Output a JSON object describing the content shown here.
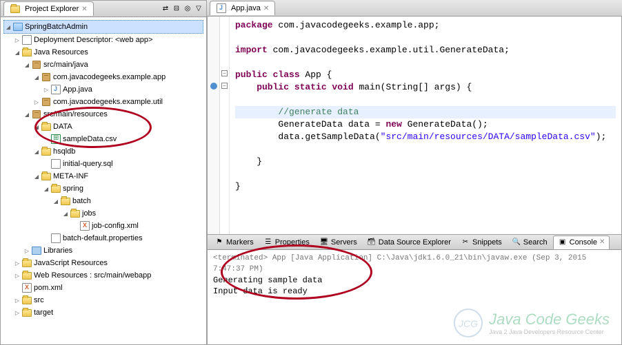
{
  "explorer": {
    "title": "Project Explorer",
    "project": "SpringBatchAdmin",
    "deploymentDescriptor": "Deployment Descriptor: <web app>",
    "javaResources": "Java Resources",
    "srcMainJava": "src/main/java",
    "pkgApp": "com.javacodegeeks.example.app",
    "appJava": "App.java",
    "pkgUtil": "com.javacodegeeks.example.util",
    "srcMainResources": "src/main/resources",
    "dataFolder": "DATA",
    "sampleData": "sampleData.csv",
    "hsqldb": "hsqldb",
    "initialQuery": "initial-query.sql",
    "metaInf": "META-INF",
    "spring": "spring",
    "batch": "batch",
    "jobs": "jobs",
    "jobConfig": "job-config.xml",
    "batchDefault": "batch-default.properties",
    "libraries": "Libraries",
    "jsResources": "JavaScript Resources",
    "webResources": "Web Resources : src/main/webapp",
    "pomXml": "pom.xml",
    "src": "src",
    "target": "target"
  },
  "editor": {
    "fileName": "App.java",
    "code": {
      "l1a": "package",
      "l1b": " com.javacodegeeks.example.app;",
      "l3a": "import",
      "l3b": " com.javacodegeeks.example.util.GenerateData;",
      "l5a": "public",
      "l5b": " class",
      "l5c": " App {",
      "l6a": "    public",
      "l6b": " static",
      "l6c": " void",
      "l6d": " main(String[] args) {",
      "l8": "        //generate data",
      "l9a": "        GenerateData data = ",
      "l9b": "new",
      "l9c": " GenerateData();",
      "l10a": "        data.getSampleData(",
      "l10b": "\"src/main/resources/DATA/sampleData.csv\"",
      "l10c": ");",
      "l12": "    }",
      "l14": "}"
    }
  },
  "bottomTabs": {
    "markers": "Markers",
    "properties": "Properties",
    "servers": "Servers",
    "dse": "Data Source Explorer",
    "snippets": "Snippets",
    "search": "Search",
    "console": "Console"
  },
  "console": {
    "terminated": "<terminated> App [Java Application] C:\\Java\\jdk1.6.0_21\\bin\\javaw.exe (Sep 3, 2015 7:47:37 PM)",
    "line1": "Generating sample data",
    "line2": "Input data is ready"
  },
  "watermark": {
    "brand": "Java Code Geeks",
    "sub": "Java 2 Java Developers Resource Center"
  }
}
